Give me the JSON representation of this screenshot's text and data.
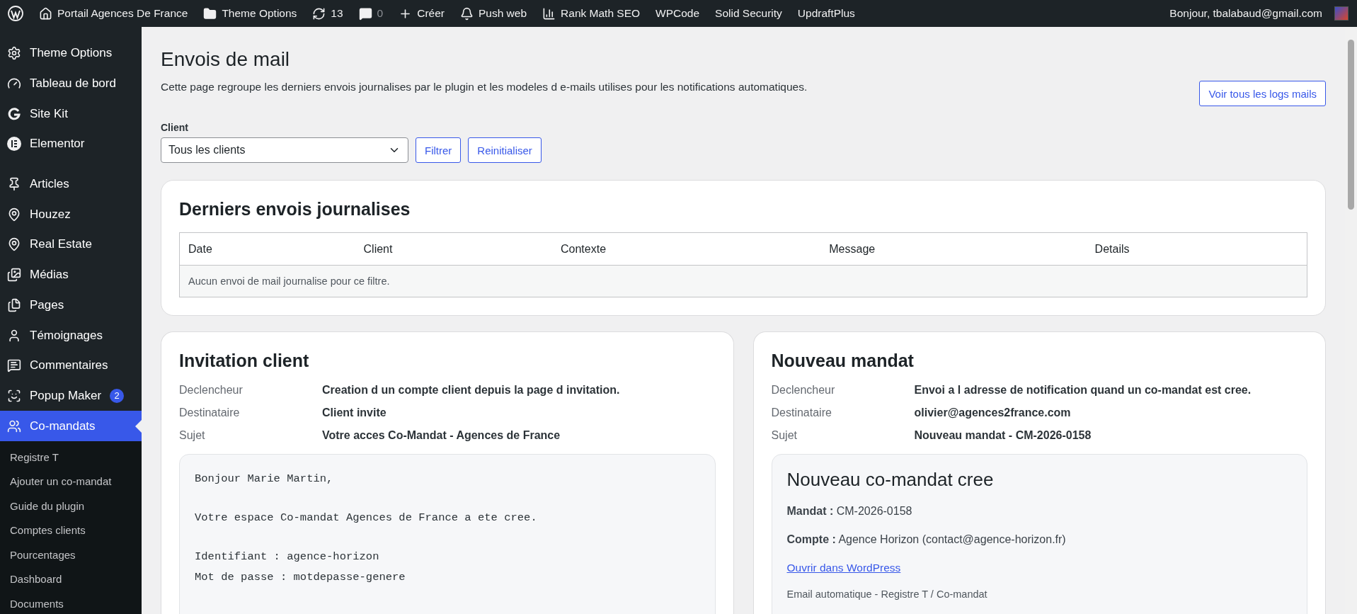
{
  "admin_bar": {
    "items": [
      {
        "label": "Portail Agences De France",
        "dim": false
      },
      {
        "label": "Theme Options",
        "dim": false
      },
      {
        "label": "13",
        "dim": false
      },
      {
        "label": "0",
        "dim": true
      },
      {
        "label": "Créer",
        "dim": false
      },
      {
        "label": "Push web",
        "dim": false
      },
      {
        "label": "Rank Math SEO",
        "dim": false
      },
      {
        "label": "WPCode",
        "dim": false
      },
      {
        "label": "Solid Security",
        "dim": false
      },
      {
        "label": "UpdraftPlus",
        "dim": false
      }
    ],
    "greeting": "Bonjour, tbalabaud@gmail.com"
  },
  "sidebar": {
    "groups": [
      {
        "items": [
          {
            "label": "Theme Options",
            "selected": false
          },
          {
            "label": "Tableau de bord",
            "selected": false
          },
          {
            "label": "Site Kit",
            "selected": false
          },
          {
            "label": "Elementor",
            "selected": false
          }
        ]
      },
      {
        "items": [
          {
            "label": "Articles",
            "selected": false
          },
          {
            "label": "Houzez",
            "selected": false
          },
          {
            "label": "Real Estate",
            "selected": false
          },
          {
            "label": "Médias",
            "selected": false
          },
          {
            "label": "Pages",
            "selected": false
          },
          {
            "label": "Témoignages",
            "selected": false
          },
          {
            "label": "Commentaires",
            "selected": false
          },
          {
            "label": "Popup Maker",
            "selected": false,
            "badge": "2"
          },
          {
            "label": "Co-mandats",
            "selected": true
          }
        ]
      }
    ],
    "submenu": [
      {
        "label": "Registre T",
        "selected": false
      },
      {
        "label": "Ajouter un co-mandat",
        "selected": false
      },
      {
        "label": "Guide du plugin",
        "selected": false
      },
      {
        "label": "Comptes clients",
        "selected": false
      },
      {
        "label": "Pourcentages",
        "selected": false
      },
      {
        "label": "Dashboard",
        "selected": false
      },
      {
        "label": "Documents",
        "selected": false
      }
    ]
  },
  "page": {
    "title": "Envois de mail",
    "description": "Cette page regroupe les derniers envois journalises par le plugin et les modeles d e-mails utilises pour les notifications automatiques.",
    "logs_button": "Voir tous les logs mails",
    "filter": {
      "label": "Client",
      "value": "Tous les clients",
      "buttons": [
        "Filtrer",
        "Reinitialiser"
      ]
    }
  },
  "log_card": {
    "title": "Derniers envois journalises",
    "columns": [
      "Date",
      "Client",
      "Contexte",
      "Message",
      "Details"
    ],
    "empty_message": "Aucun envoi de mail journalise pour ce filtre."
  },
  "templates": [
    {
      "title": "Invitation client",
      "fields": [
        {
          "label": "Declencheur",
          "value": "Creation d un compte client depuis la page d invitation."
        },
        {
          "label": "Destinataire",
          "value": "Client invite"
        },
        {
          "label": "Sujet",
          "value": "Votre acces Co-Mandat - Agences de France"
        }
      ],
      "preview": {
        "kind": "plain",
        "paragraphs": [
          [
            "Bonjour Marie Martin,"
          ],
          [
            "Votre espace Co-mandat Agences de France a ete cree."
          ],
          [
            "Identifiant : agence-horizon",
            "Mot de passe : motdepasse-genere"
          ]
        ]
      }
    },
    {
      "title": "Nouveau mandat",
      "fields": [
        {
          "label": "Declencheur",
          "value": "Envoi a l adresse de notification quand un co-mandat est cree."
        },
        {
          "label": "Destinataire",
          "value": "olivier@agences2france.com"
        },
        {
          "label": "Sujet",
          "value": "Nouveau mandat - CM-2026-0158"
        }
      ],
      "preview": {
        "kind": "html",
        "heading": "Nouveau co-mandat cree",
        "lines": [
          "**Mandat :** CM-2026-0158",
          "**Compte :** Agence Horizon (contact@agence-horizon.fr)"
        ],
        "link": "Ouvrir dans WordPress",
        "footer": "Email automatique - Registre T / Co-mandat"
      }
    }
  ]
}
